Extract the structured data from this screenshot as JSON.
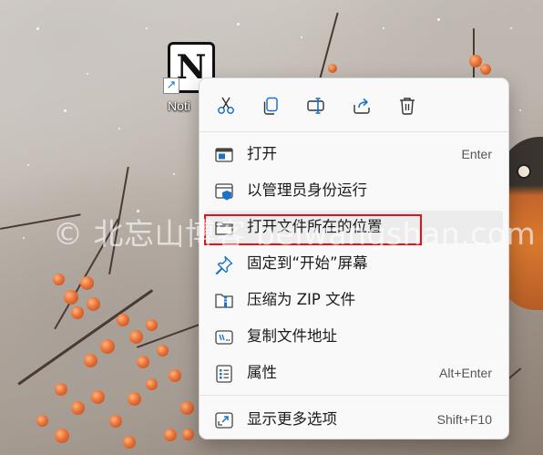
{
  "desktop": {
    "shortcut_label": "Noti"
  },
  "context_menu": {
    "toolbar": [
      {
        "name": "cut-icon"
      },
      {
        "name": "copy-icon"
      },
      {
        "name": "rename-icon"
      },
      {
        "name": "share-icon"
      },
      {
        "name": "delete-icon"
      }
    ],
    "items": [
      {
        "label": "打开",
        "accelerator": "Enter",
        "icon": "open-window-icon"
      },
      {
        "label": "以管理员身份运行",
        "accelerator": "",
        "icon": "shield-window-icon"
      },
      {
        "label": "打开文件所在的位置",
        "accelerator": "",
        "icon": "folder-icon",
        "hovered": true,
        "annotated": true
      },
      {
        "label": "固定到“开始”屏幕",
        "accelerator": "",
        "icon": "pin-icon"
      },
      {
        "label": "压缩为 ZIP 文件",
        "accelerator": "",
        "icon": "zip-folder-icon"
      },
      {
        "label": "复制文件地址",
        "accelerator": "",
        "icon": "copy-path-icon"
      },
      {
        "label": "属性",
        "accelerator": "Alt+Enter",
        "icon": "properties-icon"
      },
      {
        "label": "显示更多选项",
        "accelerator": "Shift+F10",
        "icon": "more-options-icon"
      }
    ]
  },
  "watermark": "© 北忘山博客 beiwangshan.com",
  "colors": {
    "accent": "#1a73c7",
    "annotation": "#e0121a",
    "menu_bg": "#f9f9f9"
  }
}
